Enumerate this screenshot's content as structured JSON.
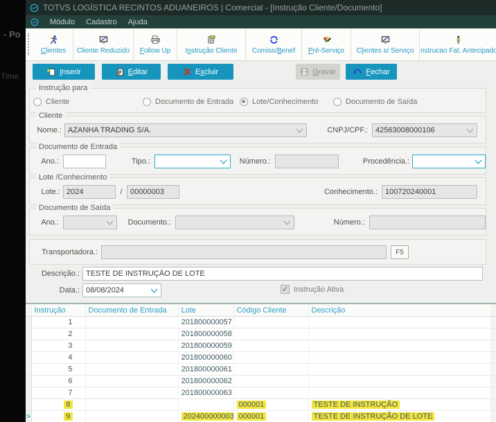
{
  "window": {
    "title": "TOTVS LOGÍSTICA RECINTOS ADUANEIROS | Comercial - [Instrução Cliente/Documento]"
  },
  "desktop_background": {
    "partial_text_top": "- Po",
    "partial_text_mid": "Time"
  },
  "menubar": {
    "items": [
      {
        "label": "Módulo"
      },
      {
        "label": "Cadastro"
      },
      {
        "label": "Ajuda"
      }
    ]
  },
  "toolbar": {
    "items": [
      {
        "label": "Clientes",
        "u": "C"
      },
      {
        "label": "Cliente Reduzido",
        "u": ""
      },
      {
        "label": "Follow Up",
        "u": "F"
      },
      {
        "label": "Instrução Cliente",
        "u": "n"
      },
      {
        "label": "Comiss/Benef",
        "u": "B"
      },
      {
        "label": "Pré-Serviço",
        "u": "P"
      },
      {
        "label": "Clientes s/ Serviço",
        "u": "l"
      },
      {
        "label": "Instrucao Fat. Antecipado",
        "u": ""
      }
    ]
  },
  "action_buttons": {
    "inserir": {
      "label": "Inserir",
      "u": "I",
      "disabled": false
    },
    "editar": {
      "label": "Editar",
      "u": "E",
      "disabled": false
    },
    "excluir": {
      "label": "Excluir",
      "u": "x",
      "disabled": false
    },
    "gravar": {
      "label": "Gravar",
      "u": "G",
      "disabled": true
    },
    "fechar": {
      "label": "Fechar",
      "u": "F",
      "disabled": false
    }
  },
  "form": {
    "instrucao_para": {
      "group_label": "Instrução para",
      "options": [
        {
          "label": "Cliente",
          "selected": false
        },
        {
          "label": "Documento de Entrada",
          "selected": false
        },
        {
          "label": "Lote/Conhecimento",
          "selected": true
        },
        {
          "label": "Documento de Saída",
          "selected": false
        }
      ]
    },
    "cliente": {
      "group_label": "Cliente",
      "nome_label": "Nome.:",
      "nome_value": "AZANHA TRADING S/A.",
      "cnpj_label": "CNPJ/CPF.:",
      "cnpj_value": "42563008000106"
    },
    "documento_entrada": {
      "group_label": "Documento de Entrada",
      "ano_label": "Ano.:",
      "ano_value": "",
      "tipo_label": "Tipo.:",
      "tipo_value": "",
      "numero_label": "Número.:",
      "numero_value": "",
      "procedencia_label": "Procedência.:",
      "procedencia_value": ""
    },
    "lote_conhecimento": {
      "group_label": "Lote /Conhecimento",
      "lote_label": "Lote.:",
      "lote_ano": "2024",
      "separator": "/",
      "lote_numero": "00000003",
      "conhecimento_label": "Conhecimento.:",
      "conhecimento_value": "100720240001"
    },
    "documento_saida": {
      "group_label": "Documento de Saída",
      "ano_label": "Ano.:",
      "ano_value": "",
      "documento_label": "Documento.:",
      "documento_value": "",
      "numero_label": "Número.:",
      "numero_value": ""
    },
    "transportadora": {
      "label": "Transportadora.:",
      "value": "",
      "f5_button": "F5"
    },
    "descricao": {
      "label": "Descrição.:",
      "value": "TESTE DE INSTRUÇÃO DE LOTE"
    },
    "data": {
      "label": "Data.:",
      "value": "08/08/2024"
    },
    "instrucao_ativa": {
      "label": "Instrução Ativa",
      "checked": true,
      "check_glyph": "✓"
    }
  },
  "table": {
    "columns": [
      "Instrução",
      "Documento de Entrada",
      "Lote",
      "Código Cliente",
      "Descrição"
    ],
    "rows": [
      {
        "instrucao": "1",
        "doc_entrada": "",
        "lote": "201800000057",
        "codigo": "",
        "descricao": "",
        "highlight": [],
        "selected": false
      },
      {
        "instrucao": "2",
        "doc_entrada": "",
        "lote": "201800000058",
        "codigo": "",
        "descricao": "",
        "highlight": [],
        "selected": false
      },
      {
        "instrucao": "3",
        "doc_entrada": "",
        "lote": "201800000059",
        "codigo": "",
        "descricao": "",
        "highlight": [],
        "selected": false
      },
      {
        "instrucao": "4",
        "doc_entrada": "",
        "lote": "201800000060",
        "codigo": "",
        "descricao": "",
        "highlight": [],
        "selected": false
      },
      {
        "instrucao": "5",
        "doc_entrada": "",
        "lote": "201800000061",
        "codigo": "",
        "descricao": "",
        "highlight": [],
        "selected": false
      },
      {
        "instrucao": "6",
        "doc_entrada": "",
        "lote": "201800000062",
        "codigo": "",
        "descricao": "",
        "highlight": [],
        "selected": false
      },
      {
        "instrucao": "7",
        "doc_entrada": "",
        "lote": "201800000063",
        "codigo": "",
        "descricao": "",
        "highlight": [],
        "selected": false
      },
      {
        "instrucao": "8",
        "doc_entrada": "",
        "lote": "",
        "codigo": "000001",
        "descricao": "TESTE DE INSTRUÇÃO",
        "highlight": [
          "instrucao",
          "codigo",
          "descricao"
        ],
        "selected": false
      },
      {
        "instrucao": "9",
        "doc_entrada": "",
        "lote": "202400000003",
        "codigo": "000001",
        "descricao": "TESTE DE INSTRUÇÃO DE LOTE",
        "highlight": [
          "instrucao",
          "lote",
          "codigo",
          "descricao"
        ],
        "selected": true
      }
    ]
  },
  "icons": {
    "row_pointer_glyph": ">"
  },
  "colors": {
    "accent_teal": "#1E9CC5",
    "button_teal": "#1795BD",
    "highlight_yellow": "#F2E43D",
    "titlebar_bg": "#1C2A28",
    "menubar_bg": "#24403A",
    "form_bg": "#EFF0ED"
  }
}
